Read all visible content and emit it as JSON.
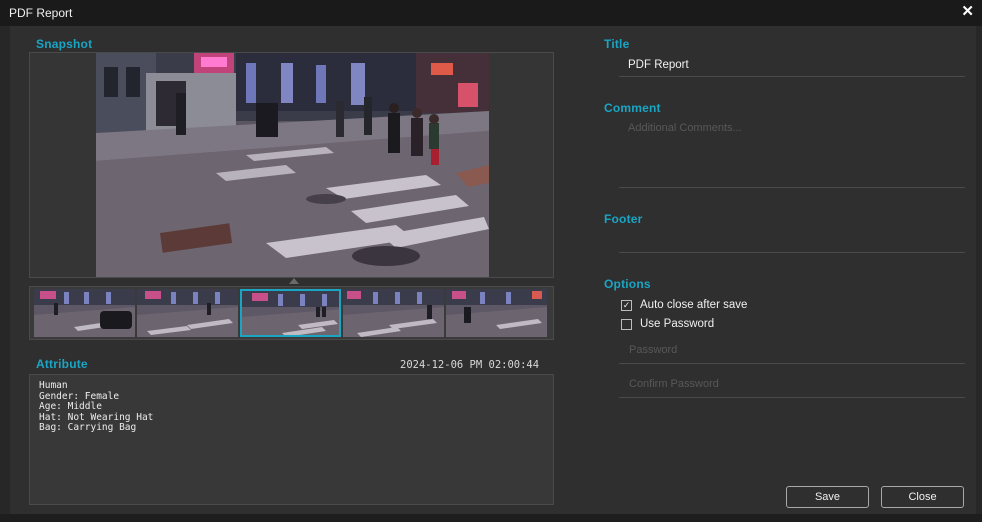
{
  "window": {
    "title": "PDF Report",
    "close_glyph": "✕"
  },
  "snapshot": {
    "label": "Snapshot",
    "thumbnails": 5,
    "selected_index": 2
  },
  "attribute": {
    "label": "Attribute",
    "timestamp": "2024-12-06 PM 02:00:44",
    "lines": [
      "Human",
      "Gender: Female",
      "Age: Middle",
      "Hat: Not Wearing Hat",
      "Bag: Carrying Bag"
    ]
  },
  "form": {
    "title_label": "Title",
    "title_value": "PDF Report",
    "comment_label": "Comment",
    "comment_placeholder": "Additional Comments...",
    "footer_label": "Footer",
    "options_label": "Options",
    "auto_close_label": "Auto close after save",
    "auto_close_checked": true,
    "use_password_label": "Use Password",
    "use_password_checked": false,
    "password_placeholder": "Password",
    "confirm_password_placeholder": "Confirm Password"
  },
  "buttons": {
    "save": "Save",
    "close": "Close"
  },
  "colors": {
    "accent": "#1aa5c5",
    "dialog_bg": "#2f2f2f",
    "titlebar_bg": "#1a1a1a"
  }
}
